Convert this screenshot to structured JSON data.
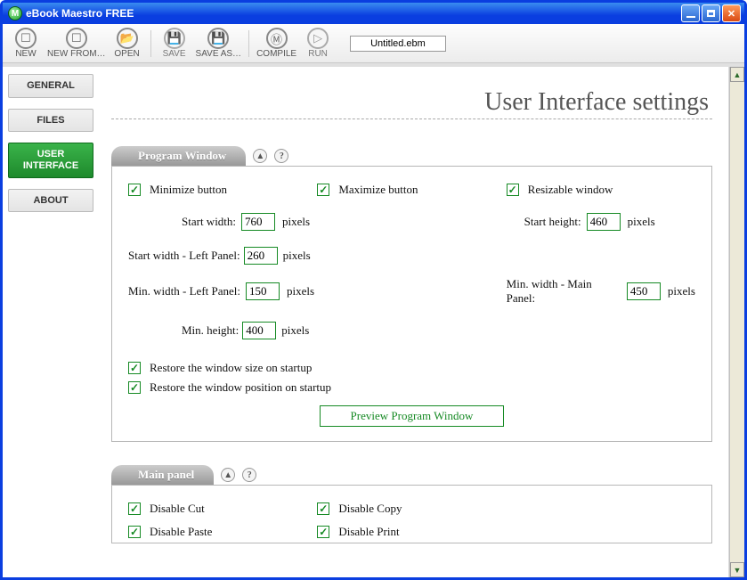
{
  "titlebar": {
    "title": "eBook Maestro FREE",
    "icon_letter": "M"
  },
  "toolbar": {
    "items": [
      {
        "label": "NEW",
        "glyph": "☐",
        "enabled": true
      },
      {
        "label": "NEW FROM…",
        "glyph": "☐",
        "enabled": true
      },
      {
        "label": "OPEN",
        "glyph": "📂",
        "enabled": true
      },
      {
        "label": "SAVE",
        "glyph": "💾",
        "enabled": false
      },
      {
        "label": "SAVE AS…",
        "glyph": "💾",
        "enabled": true
      },
      {
        "label": "COMPILE",
        "glyph": "Ⓜ",
        "enabled": true
      },
      {
        "label": "RUN",
        "glyph": "▷",
        "enabled": false
      }
    ],
    "filename": "Untitled.ebm"
  },
  "sidebar": {
    "items": [
      {
        "label": "GENERAL",
        "active": false
      },
      {
        "label": "FILES",
        "active": false
      },
      {
        "label": "USER\nINTERFACE",
        "active": true
      },
      {
        "label": "ABOUT",
        "active": false
      }
    ]
  },
  "page": {
    "title": "User Interface settings"
  },
  "sections": {
    "program_window": {
      "title": "Program Window",
      "cb_minimize": "Minimize button",
      "cb_maximize": "Maximize button",
      "cb_resizable": "Resizable window",
      "start_width_label": "Start width:",
      "start_width": "760",
      "start_height_label": "Start height:",
      "start_height": "460",
      "sw_left_label": "Start width - Left Panel:",
      "sw_left": "260",
      "mw_left_label": "Min. width - Left Panel:",
      "mw_left": "150",
      "mw_main_label": "Min. width - Main Panel:",
      "mw_main": "450",
      "min_h_label": "Min. height:",
      "min_h": "400",
      "unit": "pixels",
      "cb_restore_size": "Restore the window size on startup",
      "cb_restore_pos": "Restore the window position on startup",
      "preview_btn": "Preview Program Window"
    },
    "main_panel": {
      "title": "Main panel",
      "cb_cut": "Disable Cut",
      "cb_copy": "Disable Copy",
      "cb_paste": "Disable Paste",
      "cb_print": "Disable Print"
    }
  }
}
